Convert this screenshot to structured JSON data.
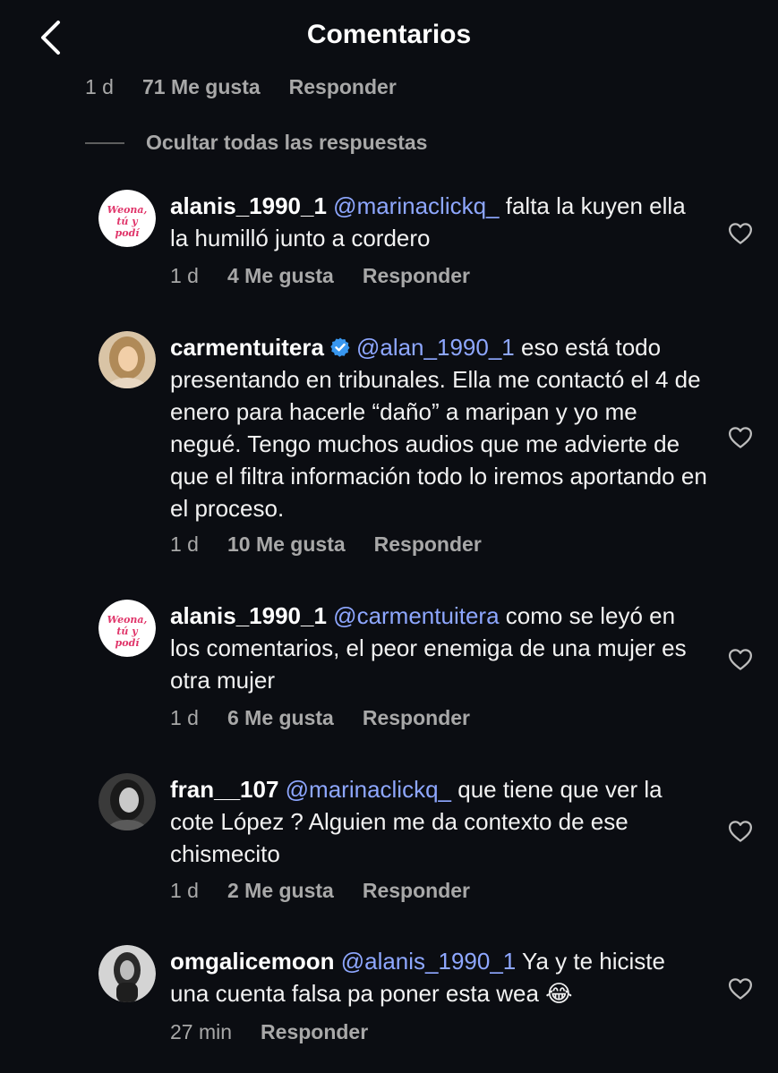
{
  "header": {
    "title": "Comentarios",
    "back_icon": "chevron-left-icon"
  },
  "parent_meta": {
    "time": "1 d",
    "likes": "71 Me gusta",
    "reply": "Responder"
  },
  "hide_replies": "Ocultar todas las respuestas",
  "colors": {
    "background": "#0b0d12",
    "mention": "#8ea7ff",
    "muted": "#a8a8a8",
    "verified": "#3897f0"
  },
  "comments": [
    {
      "user": "alanis_1990_1",
      "verified": false,
      "mention": "@marinaclickq_",
      "text": "falta la kuyen ella la humilló junto a cordero",
      "time": "1 d",
      "likes": "4 Me gusta",
      "reply": "Responder",
      "avatar_text": "Weona, tú y podí"
    },
    {
      "user": "carmentuitera",
      "verified": true,
      "mention": "@alan_1990_1",
      "text": "eso está todo presentando en tribunales. Ella me contactó el 4 de enero para hacerle “daño” a maripan y yo me negué. Tengo muchos audios que me advierte de que el filtra información todo lo iremos aportando en el proceso.",
      "time": "1 d",
      "likes": "10 Me gusta",
      "reply": "Responder"
    },
    {
      "user": "alanis_1990_1",
      "verified": false,
      "mention": "@carmentuitera",
      "text": "como se leyó en los comentarios, el peor enemiga de una mujer es otra mujer",
      "time": "1 d",
      "likes": "6 Me gusta",
      "reply": "Responder",
      "avatar_text": "Weona, tú y podí"
    },
    {
      "user": "fran__107",
      "verified": false,
      "mention": "@marinaclickq_",
      "text": "que tiene que ver la cote López ? Alguien me da contexto de ese chismecito",
      "time": "1 d",
      "likes": "2 Me gusta",
      "reply": "Responder"
    },
    {
      "user": "omgalicemoon",
      "verified": false,
      "mention": "@alanis_1990_1",
      "text": "Ya y te hiciste una cuenta falsa pa poner esta wea 😂",
      "time": "27 min",
      "likes": "",
      "reply": "Responder"
    }
  ]
}
